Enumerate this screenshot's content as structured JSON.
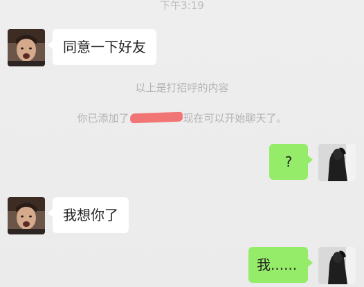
{
  "chat": {
    "timestamp": "下午3:19",
    "messages": [
      {
        "side": "in",
        "text": "同意一下好友"
      },
      {
        "side": "in",
        "text": "我想你了"
      }
    ],
    "sent": [
      {
        "text": "?"
      },
      {
        "text": "我......"
      }
    ],
    "system": {
      "greeting_note": "以上是打招呼的内容",
      "added_prefix": "你已添加了",
      "added_suffix": "现在可以开始聊天了。",
      "redaction_color": "#f26a6a"
    },
    "colors": {
      "incoming_bubble": "#ffffff",
      "outgoing_bubble": "#95ec69",
      "background": "#ececec",
      "system_text": "#b3b3b3"
    },
    "icons": {
      "incoming_avatar": "contact-avatar-photo",
      "outgoing_avatar": "self-avatar-photo"
    }
  }
}
